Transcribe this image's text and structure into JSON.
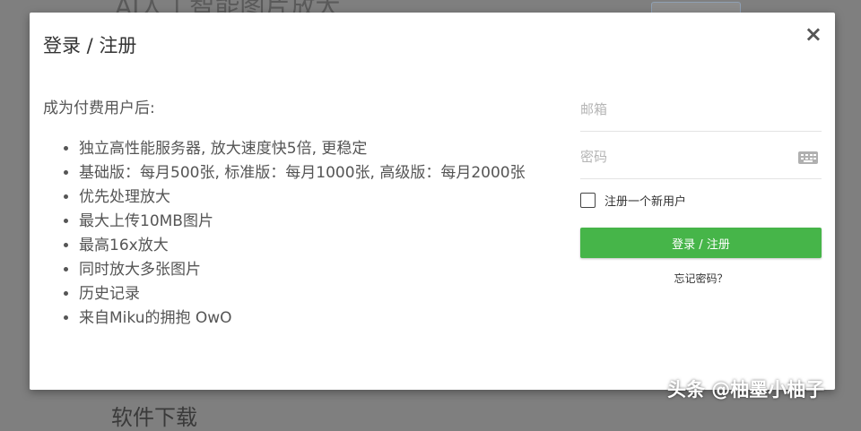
{
  "background": {
    "page_title": "AI人工智能图片放大",
    "bottom_heading": "软件下载"
  },
  "modal": {
    "title": "登录 / 注册",
    "close_symbol": "×",
    "intro": "成为付费用户后:",
    "benefits": [
      "独立高性能服务器, 放大速度快5倍, 更稳定",
      "基础版：每月500张, 标准版：每月1000张, 高级版：每月2000张",
      "优先处理放大",
      "最大上传10MB图片",
      "最高16x放大",
      "同时放大多张图片",
      "历史记录",
      "来自Miku的拥抱 OwO"
    ],
    "form": {
      "email_placeholder": "邮箱",
      "password_placeholder": "密码",
      "register_label": "注册一个新用户",
      "register_checked": false,
      "submit_label": "登录 / 注册",
      "forgot_label": "忘记密码？"
    },
    "colors": {
      "submit_bg": "#46b549"
    }
  },
  "watermark": "头条 @柚墨小柚子"
}
